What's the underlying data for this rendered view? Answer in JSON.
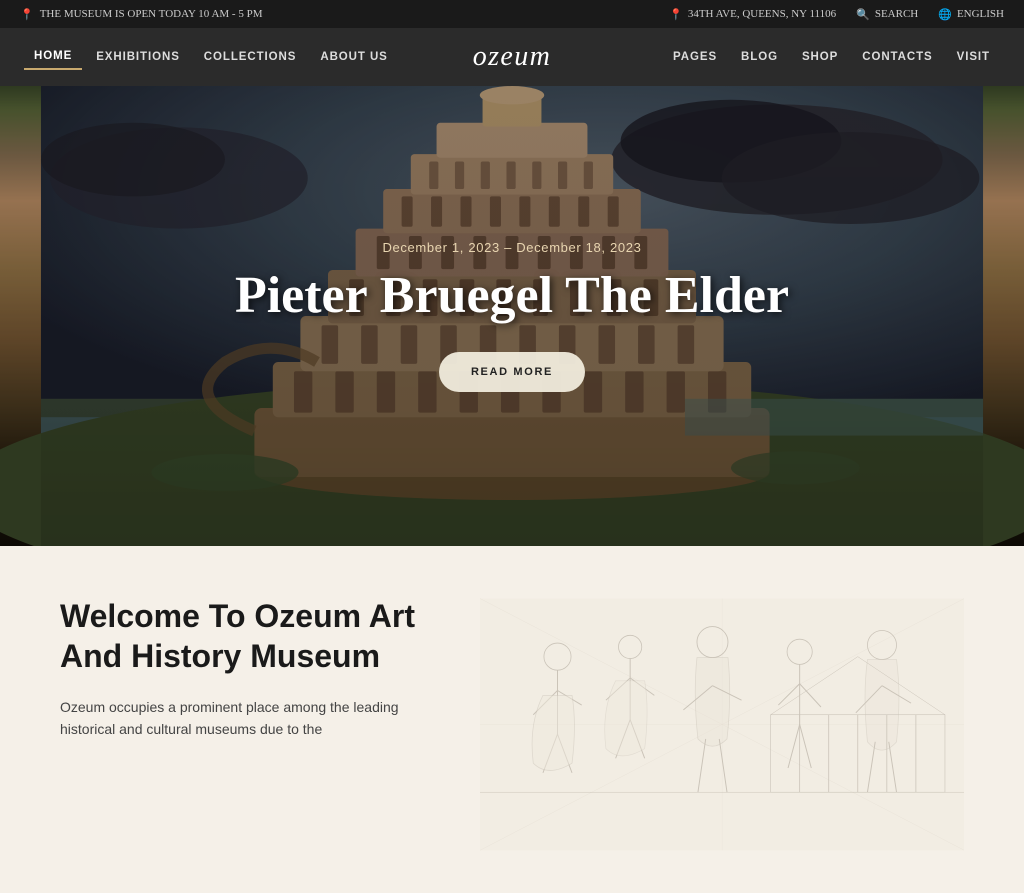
{
  "topbar": {
    "museum_hours": "THE MUSEUM IS OPEN TODAY 10 AM - 5 PM",
    "address": "34TH AVE, QUEENS, NY 11106",
    "search_label": "SEARCH",
    "language_label": "ENGLISH"
  },
  "nav": {
    "logo": "ozeum",
    "left_items": [
      {
        "label": "HOME",
        "active": true
      },
      {
        "label": "EXHIBITIONS",
        "active": false
      },
      {
        "label": "COLLECTIONS",
        "active": false
      },
      {
        "label": "ABOUT US",
        "active": false
      }
    ],
    "right_items": [
      {
        "label": "PAGES"
      },
      {
        "label": "BLOG"
      },
      {
        "label": "SHOP"
      },
      {
        "label": "CONTACTS"
      },
      {
        "label": "VISIT"
      }
    ]
  },
  "hero": {
    "date_range": "December 1, 2023 – December 18, 2023",
    "title": "Pieter Bruegel The Elder",
    "cta_label": "READ MORE"
  },
  "welcome": {
    "title": "Welcome To Ozeum Art And History Museum",
    "description": "Ozeum occupies a prominent place among the leading historical and cultural museums due to the"
  }
}
